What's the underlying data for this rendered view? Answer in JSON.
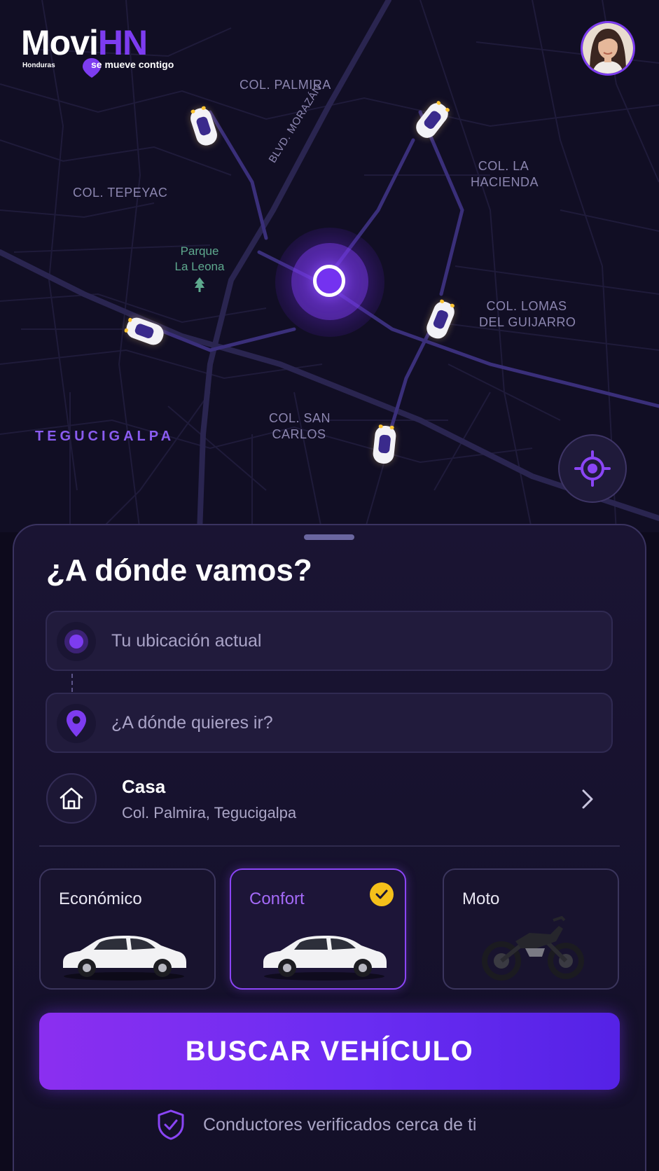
{
  "brand": {
    "logo_text_white": "Movi",
    "logo_text_purple": "HN",
    "country": "Honduras",
    "tagline": "se mueve contigo"
  },
  "map": {
    "labels": {
      "palmira": "COL. PALMIRA",
      "tepeyac": "COL. TEPEYAC",
      "hacienda_line1": "COL. LA",
      "hacienda_line2": "HACIENDA",
      "lomas_line1": "COL. LOMAS",
      "lomas_line2": "DEL GUIJARRO",
      "sancarlos_line1": "COL. SAN",
      "sancarlos_line2": "CARLOS",
      "city": "TEGUCIGALPA",
      "boulevard": "BLVD. MORAZÁN",
      "park_line1": "Parque",
      "park_line2": "La Leona"
    },
    "icons": {
      "current_location": "location-pulse-icon",
      "recenter": "crosshair-icon",
      "car": "car-top-icon",
      "park": "tree-icon"
    }
  },
  "sheet": {
    "title": "¿A dónde vamos?",
    "origin_placeholder": "Tu ubicación actual",
    "destination_placeholder": "¿A dónde quieres ir?",
    "saved_place": {
      "name": "Casa",
      "address": "Col. Palmira, Tegucigalpa",
      "icon": "home-icon"
    },
    "vehicles": [
      {
        "label": "Económico",
        "selected": false,
        "icon": "sedan-icon"
      },
      {
        "label": "Confort",
        "selected": true,
        "icon": "sedan-icon"
      },
      {
        "label": "Moto",
        "selected": false,
        "icon": "motorcycle-icon"
      }
    ],
    "cta_label": "BUSCAR VEHÍCULO",
    "footer_note": "Conductores verificados cerca de ti"
  },
  "colors": {
    "accent": "#7d3cf0",
    "selected_check": "#f5c01a",
    "background": "#0d0a1c"
  }
}
